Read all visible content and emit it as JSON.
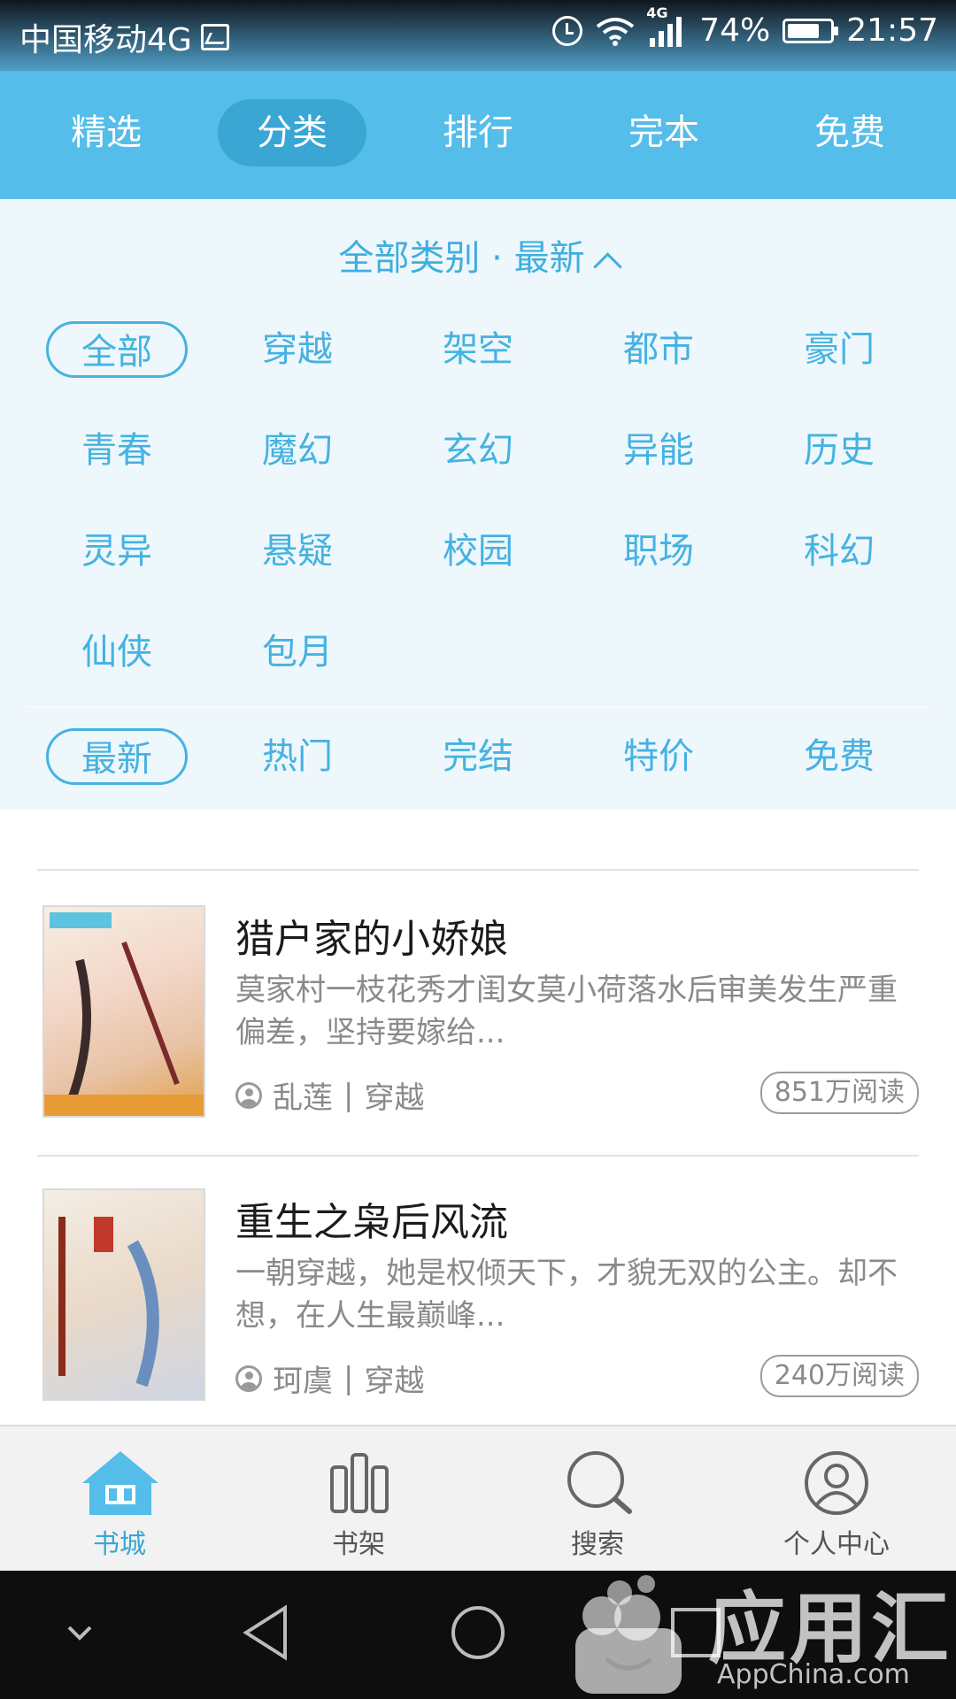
{
  "status_bar": {
    "carrier": "中国移动4G",
    "network_badge": "4G",
    "battery": "74%",
    "time": "21:57"
  },
  "top_tabs": [
    {
      "label": "精选",
      "active": false
    },
    {
      "label": "分类",
      "active": true
    },
    {
      "label": "排行",
      "active": false
    },
    {
      "label": "完本",
      "active": false
    },
    {
      "label": "免费",
      "active": false
    }
  ],
  "filter_panel": {
    "header": "全部类别 · 最新",
    "categories": [
      "全部",
      "穿越",
      "架空",
      "都市",
      "豪门",
      "青春",
      "魔幻",
      "玄幻",
      "异能",
      "历史",
      "灵异",
      "悬疑",
      "校园",
      "职场",
      "科幻",
      "仙侠",
      "包月"
    ],
    "selected_category": "全部",
    "sorts": [
      "最新",
      "热门",
      "完结",
      "特价",
      "免费"
    ],
    "selected_sort": "最新"
  },
  "books": [
    {
      "title": "猎户家的小娇娘",
      "desc": "莫家村一枝花秀才闺女莫小荷落水后审美发生严重偏差，坚持要嫁给...",
      "author": "乱莲",
      "genre": "穿越",
      "reads": "851万阅读"
    },
    {
      "title": "重生之枭后风流",
      "desc": "一朝穿越，她是权倾天下，才貌无双的公主。却不想，在人生最巅峰...",
      "author": "珂虞",
      "genre": "穿越",
      "reads": "240万阅读"
    }
  ],
  "bottom_nav": [
    {
      "label": "书城",
      "icon": "bookstore-home-icon",
      "active": true
    },
    {
      "label": "书架",
      "icon": "bookshelf-icon",
      "active": false
    },
    {
      "label": "搜索",
      "icon": "search-icon",
      "active": false
    },
    {
      "label": "个人中心",
      "icon": "profile-icon",
      "active": false
    }
  ],
  "watermark": {
    "brand": "应用汇",
    "brand_en": "AppChina.com"
  },
  "colors": {
    "accent": "#55bde9",
    "accent_dark": "#3aa6d3",
    "chip_text": "#45b2e2",
    "panel_bg": "#eef7fb"
  }
}
